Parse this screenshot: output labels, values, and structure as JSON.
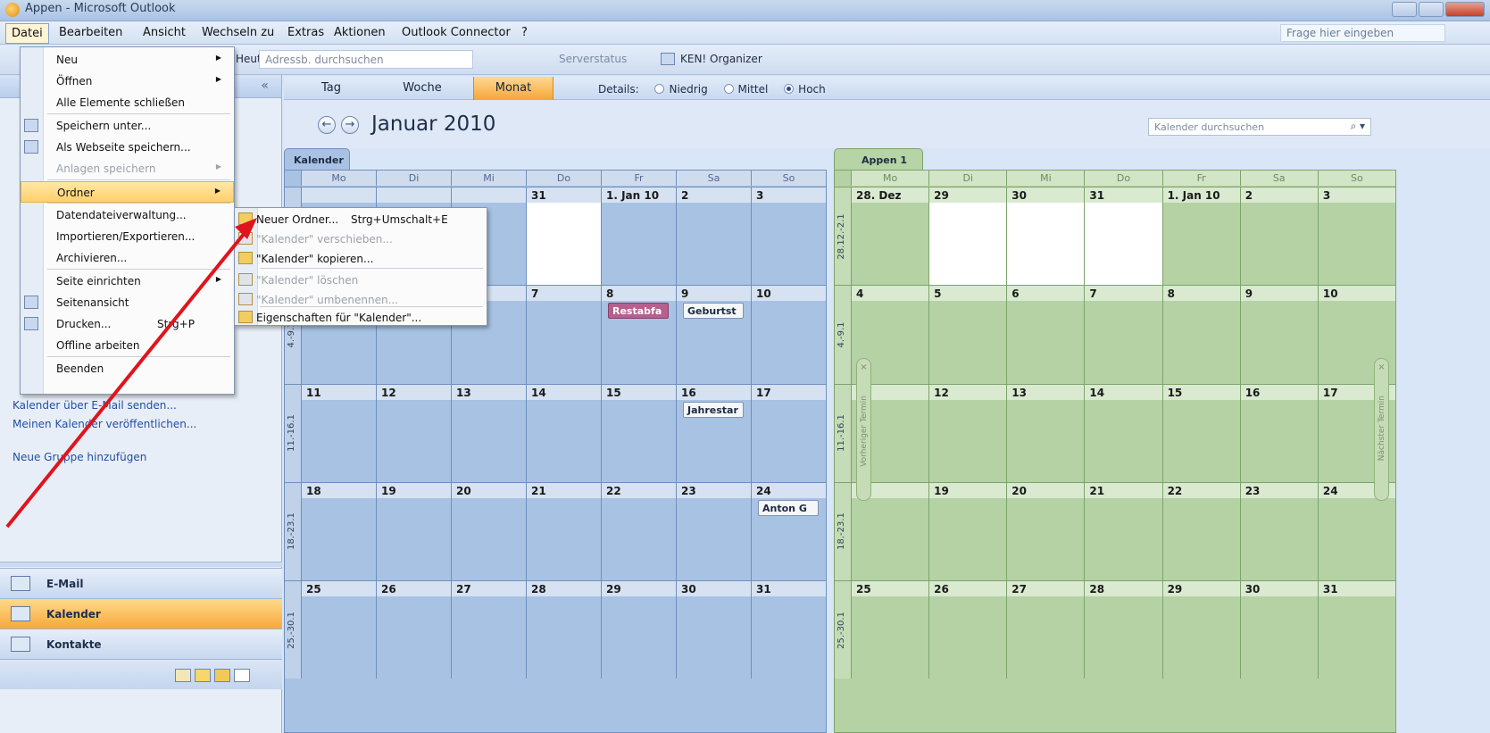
{
  "window": {
    "title": "Appen - Microsoft Outlook"
  },
  "menubar": {
    "items": [
      "Datei",
      "Bearbeiten",
      "Ansicht",
      "Wechseln zu",
      "Extras",
      "Aktionen",
      "Outlook Connector",
      "?"
    ],
    "help_placeholder": "Frage hier eingeben"
  },
  "toolbar": {
    "today": "Heute",
    "address_search": "Adressb. durchsuchen",
    "server_status": "Serverstatus",
    "ken_organizer": "KEN! Organizer"
  },
  "file_menu": {
    "items": [
      {
        "label": "Neu",
        "submenu": true,
        "icon": "",
        "disabled": false
      },
      {
        "label": "Öffnen",
        "submenu": true,
        "icon": "",
        "disabled": false
      },
      {
        "label": "Alle Elemente schließen",
        "icon": "",
        "disabled": false
      },
      {
        "label": "Speichern unter...",
        "icon": "save-icon",
        "disabled": false
      },
      {
        "label": "Als Webseite speichern...",
        "icon": "web-save-icon",
        "disabled": false
      },
      {
        "label": "Anlagen speichern",
        "submenu": true,
        "icon": "",
        "disabled": true
      },
      {
        "label": "Ordner",
        "submenu": true,
        "icon": "",
        "disabled": false,
        "highlighted": true
      },
      {
        "label": "Datendateiverwaltung...",
        "icon": "",
        "disabled": false
      },
      {
        "label": "Importieren/Exportieren...",
        "icon": "",
        "disabled": false
      },
      {
        "label": "Archivieren...",
        "icon": "",
        "disabled": false
      },
      {
        "label": "Seite einrichten",
        "submenu": true,
        "icon": "",
        "disabled": false
      },
      {
        "label": "Seitenansicht",
        "icon": "print-preview-icon",
        "disabled": false
      },
      {
        "label": "Drucken...",
        "shortcut": "Strg+P",
        "icon": "printer-icon",
        "disabled": false
      },
      {
        "label": "Offline arbeiten",
        "icon": "",
        "disabled": false
      },
      {
        "label": "Beenden",
        "icon": "",
        "disabled": false
      }
    ]
  },
  "folder_submenu": {
    "items": [
      {
        "label": "Neuer Ordner...",
        "shortcut": "Strg+Umschalt+E",
        "icon": "new-folder-icon",
        "disabled": false
      },
      {
        "label": "\"Kalender\" verschieben...",
        "icon": "move-folder-icon",
        "disabled": true
      },
      {
        "label": "\"Kalender\" kopieren...",
        "icon": "copy-folder-icon",
        "disabled": false
      },
      {
        "label": "\"Kalender\" löschen",
        "icon": "delete-folder-icon",
        "disabled": true
      },
      {
        "label": "\"Kalender\" umbenennen...",
        "icon": "rename-icon",
        "disabled": true
      },
      {
        "label": "Eigenschaften für \"Kalender\"...",
        "icon": "properties-icon",
        "disabled": false
      }
    ]
  },
  "navpane": {
    "links": [
      "Kalender über E-Mail senden...",
      "Meinen Kalender veröffentlichen...",
      "Neue Gruppe hinzufügen"
    ],
    "buttons": [
      "E-Mail",
      "Kalender",
      "Kontakte"
    ]
  },
  "view": {
    "tabs": [
      "Tag",
      "Woche",
      "Monat"
    ],
    "selected_tab": "Monat",
    "details_label": "Details:",
    "details_options": [
      "Niedrig",
      "Mittel",
      "Hoch"
    ],
    "details_selected": "Hoch",
    "month_title": "Januar 2010",
    "search_placeholder": "Kalender durchsuchen"
  },
  "day_headers": [
    "Mo",
    "Di",
    "Mi",
    "Do",
    "Fr",
    "Sa",
    "So"
  ],
  "calendar_left": {
    "tab_label": "Kalender",
    "color_bg": "#a7c2e3",
    "weeks": [
      {
        "label": "",
        "days": [
          "",
          "",
          "",
          "31",
          "1. Jan 10",
          "2",
          "3"
        ]
      },
      {
        "label": "4.-9.1",
        "days": [
          "",
          "",
          "",
          "7",
          "8",
          "9",
          "10"
        ]
      },
      {
        "label": "11.-16.1",
        "days": [
          "11",
          "12",
          "13",
          "14",
          "15",
          "16",
          "17"
        ]
      },
      {
        "label": "18.-23.1",
        "days": [
          "18",
          "19",
          "20",
          "21",
          "22",
          "23",
          "24"
        ]
      },
      {
        "label": "25.-30.1",
        "days": [
          "25",
          "26",
          "27",
          "28",
          "29",
          "30",
          "31"
        ]
      }
    ],
    "appointments": [
      {
        "week": 1,
        "day": 4,
        "text": "Restabfa",
        "style": "purple"
      },
      {
        "week": 1,
        "day": 5,
        "text": "Geburtst",
        "style": "white"
      },
      {
        "week": 2,
        "day": 5,
        "text": "Jahrestar",
        "style": "white"
      },
      {
        "week": 3,
        "day": 6,
        "text": "Anton G",
        "style": "white"
      }
    ]
  },
  "calendar_right": {
    "tab_label": "Appen 1",
    "color_bg": "#b4d2a4",
    "weeks": [
      {
        "label": "28.12.-2.1",
        "days": [
          "28. Dez",
          "29",
          "30",
          "31",
          "1. Jan 10",
          "2",
          "3"
        ]
      },
      {
        "label": "4.-9.1",
        "days": [
          "4",
          "5",
          "6",
          "7",
          "8",
          "9",
          "10"
        ]
      },
      {
        "label": "11.-16.1",
        "days": [
          "",
          "12",
          "13",
          "14",
          "15",
          "16",
          "17"
        ]
      },
      {
        "label": "18.-23.1",
        "days": [
          "",
          "19",
          "20",
          "21",
          "22",
          "23",
          "24"
        ]
      },
      {
        "label": "25.-30.1",
        "days": [
          "25",
          "26",
          "27",
          "28",
          "29",
          "30",
          "31"
        ]
      }
    ],
    "prev_label": "Vorheriger Termin",
    "next_label": "Nächster Termin"
  }
}
